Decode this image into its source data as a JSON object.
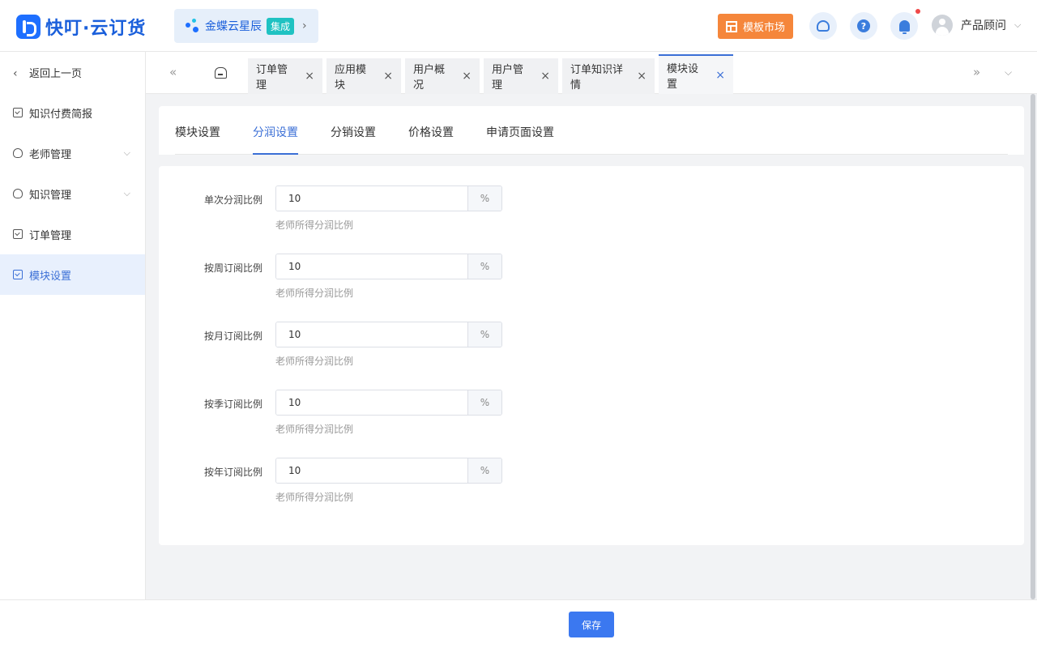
{
  "header": {
    "logo_text": "快叮·云订货",
    "integration_name": "金蝶云星辰",
    "integration_badge": "集成",
    "integration_chevron": "›",
    "market_label": "模板市场",
    "help_glyph": "?",
    "user_name": "产品顾问",
    "user_chevron": "⌵"
  },
  "sidebar": {
    "back_label": "返回上一页",
    "back_glyph": "‹",
    "items": [
      {
        "label": "知识付费简报"
      },
      {
        "label": "老师管理"
      },
      {
        "label": "知识管理"
      },
      {
        "label": "订单管理"
      },
      {
        "label": "模块设置"
      }
    ],
    "chevron": "⌵"
  },
  "tabbar": {
    "prev_glyph": "«",
    "next_glyph": "»",
    "menu_glyph": "⌵",
    "close_glyph": "×",
    "tabs": [
      {
        "label": "订单管理"
      },
      {
        "label": "应用模块"
      },
      {
        "label": "用户概况"
      },
      {
        "label": "用户管理"
      },
      {
        "label": "订单知识详情"
      },
      {
        "label": "模块设置"
      }
    ]
  },
  "subtabs": [
    {
      "label": "模块设置"
    },
    {
      "label": "分润设置"
    },
    {
      "label": "分销设置"
    },
    {
      "label": "价格设置"
    },
    {
      "label": "申请页面设置"
    }
  ],
  "form": {
    "unit": "%",
    "rows": [
      {
        "label": "单次分润比例",
        "value": "10",
        "hint": "老师所得分润比例"
      },
      {
        "label": "按周订阅比例",
        "value": "10",
        "hint": "老师所得分润比例"
      },
      {
        "label": "按月订阅比例",
        "value": "10",
        "hint": "老师所得分润比例"
      },
      {
        "label": "按季订阅比例",
        "value": "10",
        "hint": "老师所得分润比例"
      },
      {
        "label": "按年订阅比例",
        "value": "10",
        "hint": "老师所得分润比例"
      }
    ]
  },
  "footer": {
    "save_label": "保存"
  },
  "colors": {
    "primary": "#3b78f0",
    "brand": "#1a5fdb",
    "market": "#f5863b",
    "badge": "#1fc2c2",
    "active_bg": "#e8f0fd"
  }
}
